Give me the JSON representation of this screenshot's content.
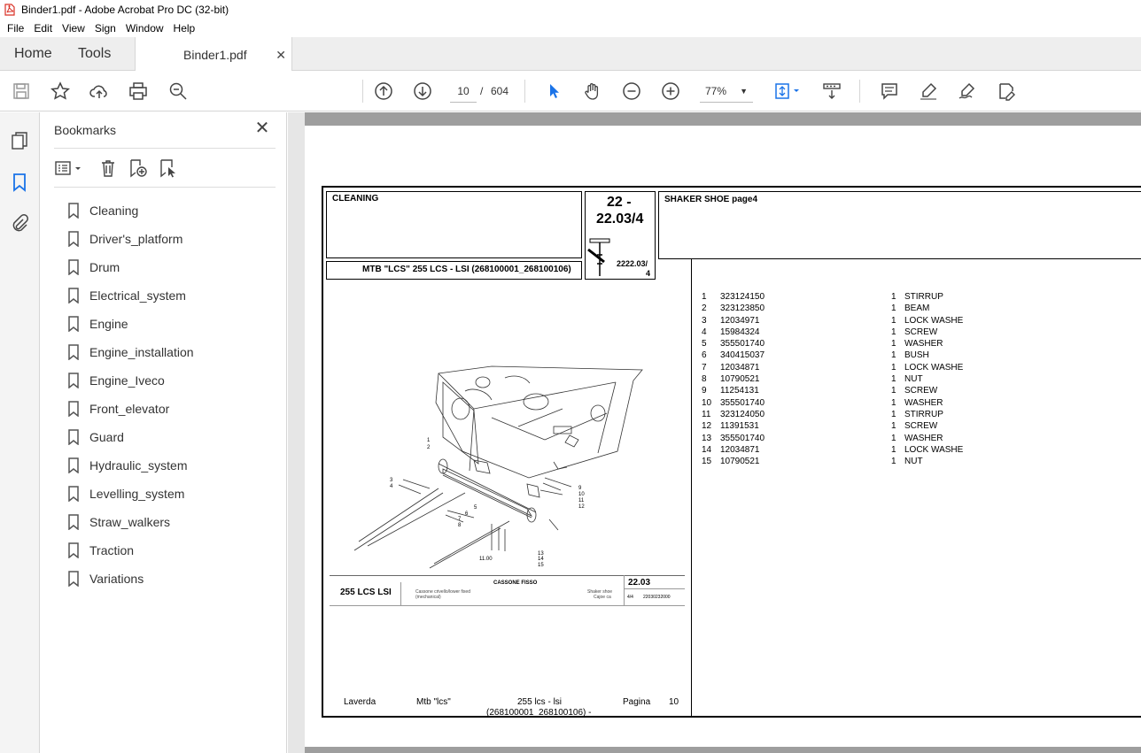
{
  "window": {
    "title": "Binder1.pdf - Adobe Acrobat Pro DC (32-bit)"
  },
  "menu": [
    "File",
    "Edit",
    "View",
    "Sign",
    "Window",
    "Help"
  ],
  "tabs": {
    "home": "Home",
    "tools": "Tools",
    "document": "Binder1.pdf"
  },
  "toolbar": {
    "current_page": "10",
    "page_separator": "/",
    "total_pages": "604",
    "zoom": "77%"
  },
  "bookmarks": {
    "title": "Bookmarks",
    "items": [
      "Cleaning",
      "Driver's_platform",
      "Drum",
      "Electrical_system",
      "Engine",
      "Engine_installation",
      "Engine_Iveco",
      "Front_elevator",
      "Guard",
      "Hydraulic_system",
      "Levelling_system",
      "Straw_walkers",
      "Traction",
      "Variations"
    ]
  },
  "pdf": {
    "section": "CLEANING",
    "code_line1": "22 -",
    "code_line2": "22.03/4",
    "icon_ref_line1": "2222.03/",
    "icon_ref_line2": "4",
    "page_title": "SHAKER SHOE  page4",
    "machine_line": "MTB \"LCS\" 255 LCS - LSI (268100001_268100106)",
    "parts": [
      {
        "num": "1",
        "code": "323124150",
        "qty": "1",
        "desc": "STIRRUP"
      },
      {
        "num": "2",
        "code": "323123850",
        "qty": "1",
        "desc": "BEAM"
      },
      {
        "num": "3",
        "code": "12034971",
        "qty": "1",
        "desc": "LOCK WASHE"
      },
      {
        "num": "4",
        "code": "15984324",
        "qty": "1",
        "desc": "SCREW"
      },
      {
        "num": "5",
        "code": "355501740",
        "qty": "1",
        "desc": "WASHER"
      },
      {
        "num": "6",
        "code": "340415037",
        "qty": "1",
        "desc": "BUSH"
      },
      {
        "num": "7",
        "code": "12034871",
        "qty": "1",
        "desc": "LOCK WASHE"
      },
      {
        "num": "8",
        "code": "10790521",
        "qty": "1",
        "desc": "NUT"
      },
      {
        "num": "9",
        "code": "11254131",
        "qty": "1",
        "desc": "SCREW"
      },
      {
        "num": "10",
        "code": "355501740",
        "qty": "1",
        "desc": "WASHER"
      },
      {
        "num": "11",
        "code": "323124050",
        "qty": "1",
        "desc": "STIRRUP"
      },
      {
        "num": "12",
        "code": "11391531",
        "qty": "1",
        "desc": "SCREW"
      },
      {
        "num": "13",
        "code": "355501740",
        "qty": "1",
        "desc": "WASHER"
      },
      {
        "num": "14",
        "code": "12034871",
        "qty": "1",
        "desc": "LOCK WASHE"
      },
      {
        "num": "15",
        "code": "10790521",
        "qty": "1",
        "desc": "NUT"
      }
    ],
    "drawing_labels": [
      "1",
      "2",
      "3",
      "4",
      "5",
      "6",
      "7",
      "8",
      "9",
      "10",
      "11",
      "12",
      "13",
      "14",
      "15",
      "11.00"
    ],
    "title_block": {
      "model": "255 LCS LSI",
      "group": "CASSONE FISSO",
      "it_desc_1": "Cassone crivello/lower fixed",
      "it_desc_2": "(mechanical)",
      "en_desc_1": "Shaker shoe",
      "en_desc_2": "Cajoe ca",
      "code": "22.03",
      "page_frac": "4/4",
      "drawing_no": "22030232000"
    },
    "footer": {
      "brand": "Laverda",
      "model": "Mtb \"lcs\"",
      "variant": "255 lcs - lsi",
      "serials": "(268100001_268100106) -",
      "page_label": "Pagina",
      "page_no": "10"
    }
  }
}
